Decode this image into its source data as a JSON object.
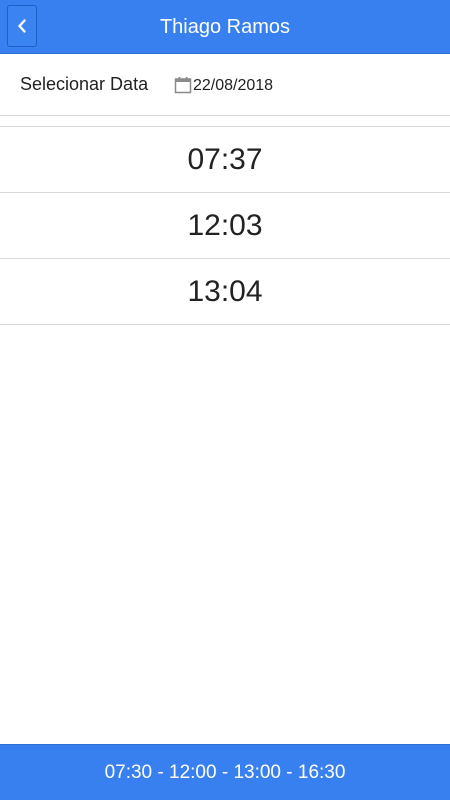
{
  "header": {
    "title": "Thiago Ramos",
    "back_icon": "chevron-left-icon"
  },
  "date_selector": {
    "label": "Selecionar Data",
    "icon": "calendar-icon",
    "value": "22/08/2018"
  },
  "punches": [
    {
      "time": "07:37"
    },
    {
      "time": "12:03"
    },
    {
      "time": "13:04"
    }
  ],
  "footer": {
    "schedule": "07:30 - 12:00 - 13:00 - 16:30"
  },
  "colors": {
    "accent": "#3880ef",
    "divider": "#d8d8d8"
  }
}
